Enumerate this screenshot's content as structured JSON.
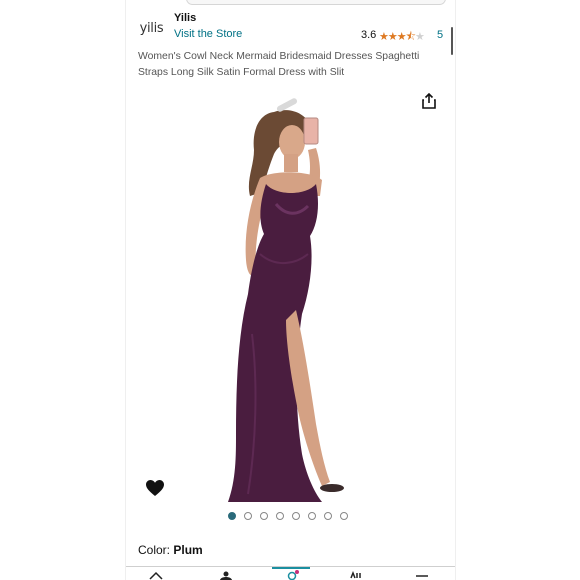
{
  "store": {
    "logo_text": "yilis",
    "brand_name": "Yilis",
    "visit_label": "Visit the Store",
    "rating": "3.6",
    "rating_stars": 3.6,
    "review_count": "5"
  },
  "product": {
    "title": "Women's Cowl Neck Mermaid Bridesmaid Dresses Spaghetti Straps Long Silk Satin Formal Dress with Slit",
    "image_count": 8,
    "active_image": 1
  },
  "variation": {
    "label": "Color:",
    "value": "Plum"
  },
  "colors": {
    "link": "#007185",
    "star": "#de7921",
    "dress": "#4a1d3f",
    "accent": "#1b8fa0"
  },
  "icons": {
    "share": "share-icon",
    "wishlist": "heart-icon",
    "nav": [
      "home-icon",
      "profile-icon",
      "cart-icon",
      "menu-icon"
    ]
  }
}
